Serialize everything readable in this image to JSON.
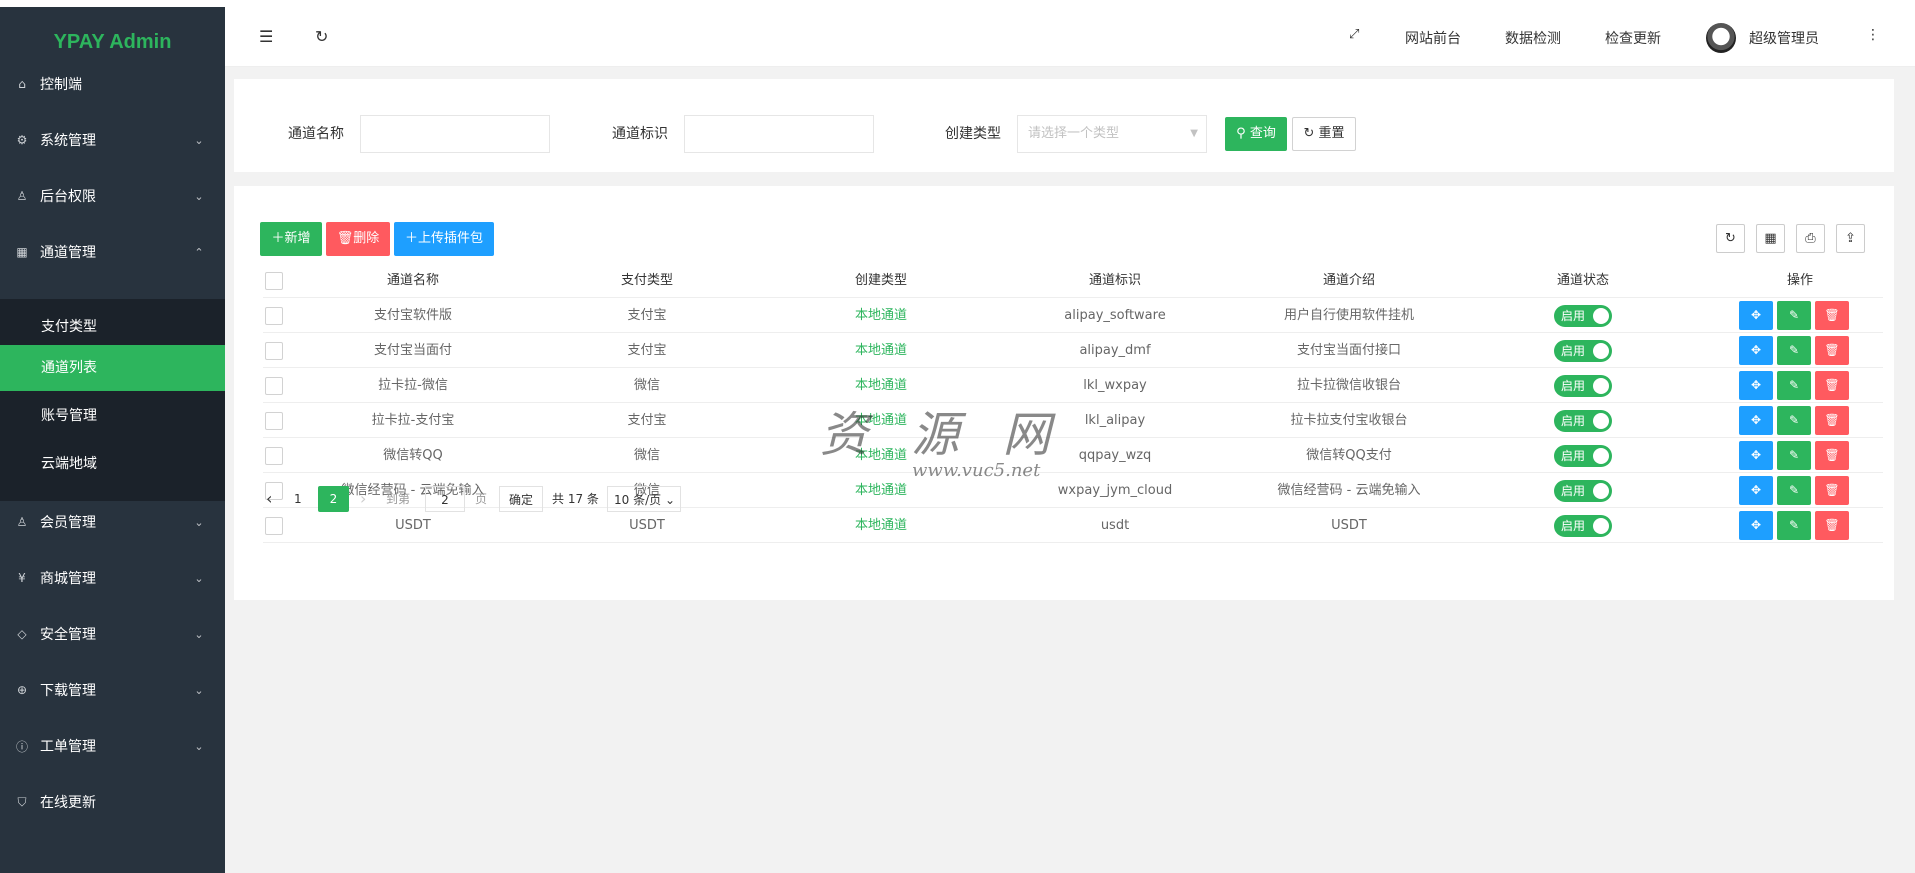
{
  "app": {
    "title": "YPAY Admin",
    "accent": "#2db55d"
  },
  "topbar": {
    "links": [
      "网站前台",
      "数据检测",
      "检查更新"
    ],
    "user": "超级管理员"
  },
  "sidebar": {
    "items": [
      {
        "label": "控制端",
        "icon": "home-icon",
        "arrow": ""
      },
      {
        "label": "系统管理",
        "icon": "gear-icon",
        "arrow": "chevron-down"
      },
      {
        "label": "后台权限",
        "icon": "user-icon",
        "arrow": "chevron-down"
      },
      {
        "label": "通道管理",
        "icon": "grid-icon",
        "arrow": "chevron-up"
      },
      {
        "label": "会员管理",
        "icon": "user-icon",
        "arrow": "chevron-down"
      },
      {
        "label": "商城管理",
        "icon": "yen-icon",
        "arrow": "chevron-down"
      },
      {
        "label": "安全管理",
        "icon": "diamond-icon",
        "arrow": "chevron-down"
      },
      {
        "label": "下载管理",
        "icon": "download-icon",
        "arrow": "chevron-down"
      },
      {
        "label": "工单管理",
        "icon": "info-icon",
        "arrow": "chevron-down"
      },
      {
        "label": "在线更新",
        "icon": "shield-check-icon",
        "arrow": ""
      }
    ],
    "submenu": [
      "支付类型",
      "通道列表",
      "账号管理",
      "云端地域"
    ]
  },
  "search": {
    "name_label": "通道名称",
    "id_label": "通道标识",
    "type_label": "创建类型",
    "type_placeholder": "请选择一个类型",
    "query_label": "查询",
    "reset_label": "重置"
  },
  "toolbar": {
    "add_label": "新增",
    "delete_label": "删除",
    "upload_label": "上传插件包"
  },
  "table": {
    "columns": [
      "通道名称",
      "支付类型",
      "创建类型",
      "通道标识",
      "通道介绍",
      "通道状态",
      "操作"
    ],
    "rows": [
      {
        "name": "支付宝软件版",
        "pay_type": "支付宝",
        "create_type": "本地通道",
        "code": "alipay_software",
        "intro": "用户自行使用软件挂机",
        "status": "启用"
      },
      {
        "name": "支付宝当面付",
        "pay_type": "支付宝",
        "create_type": "本地通道",
        "code": "alipay_dmf",
        "intro": "支付宝当面付接口",
        "status": "启用"
      },
      {
        "name": "拉卡拉-微信",
        "pay_type": "微信",
        "create_type": "本地通道",
        "code": "lkl_wxpay",
        "intro": "拉卡拉微信收银台",
        "status": "启用"
      },
      {
        "name": "拉卡拉-支付宝",
        "pay_type": "支付宝",
        "create_type": "本地通道",
        "code": "lkl_alipay",
        "intro": "拉卡拉支付宝收银台",
        "status": "启用"
      },
      {
        "name": "微信转QQ",
        "pay_type": "微信",
        "create_type": "本地通道",
        "code": "qqpay_wzq",
        "intro": "微信转QQ支付",
        "status": "启用"
      },
      {
        "name": "微信经营码 - 云端免输入",
        "pay_type": "微信",
        "create_type": "本地通道",
        "code": "wxpay_jym_cloud",
        "intro": "微信经营码 - 云端免输入",
        "status": "启用"
      },
      {
        "name": "USDT",
        "pay_type": "USDT",
        "create_type": "本地通道",
        "code": "usdt",
        "intro": "USDT",
        "status": "启用"
      }
    ]
  },
  "pager": {
    "pages": [
      "1",
      "2"
    ],
    "current": "2",
    "goto_label": "到第",
    "goto_value": "2",
    "page_suffix": "页",
    "confirm_label": "确定",
    "total": "共 17 条",
    "page_size": "10 条/页"
  },
  "watermark": {
    "main": "资 源 网",
    "url": "www.vuc5.net"
  }
}
